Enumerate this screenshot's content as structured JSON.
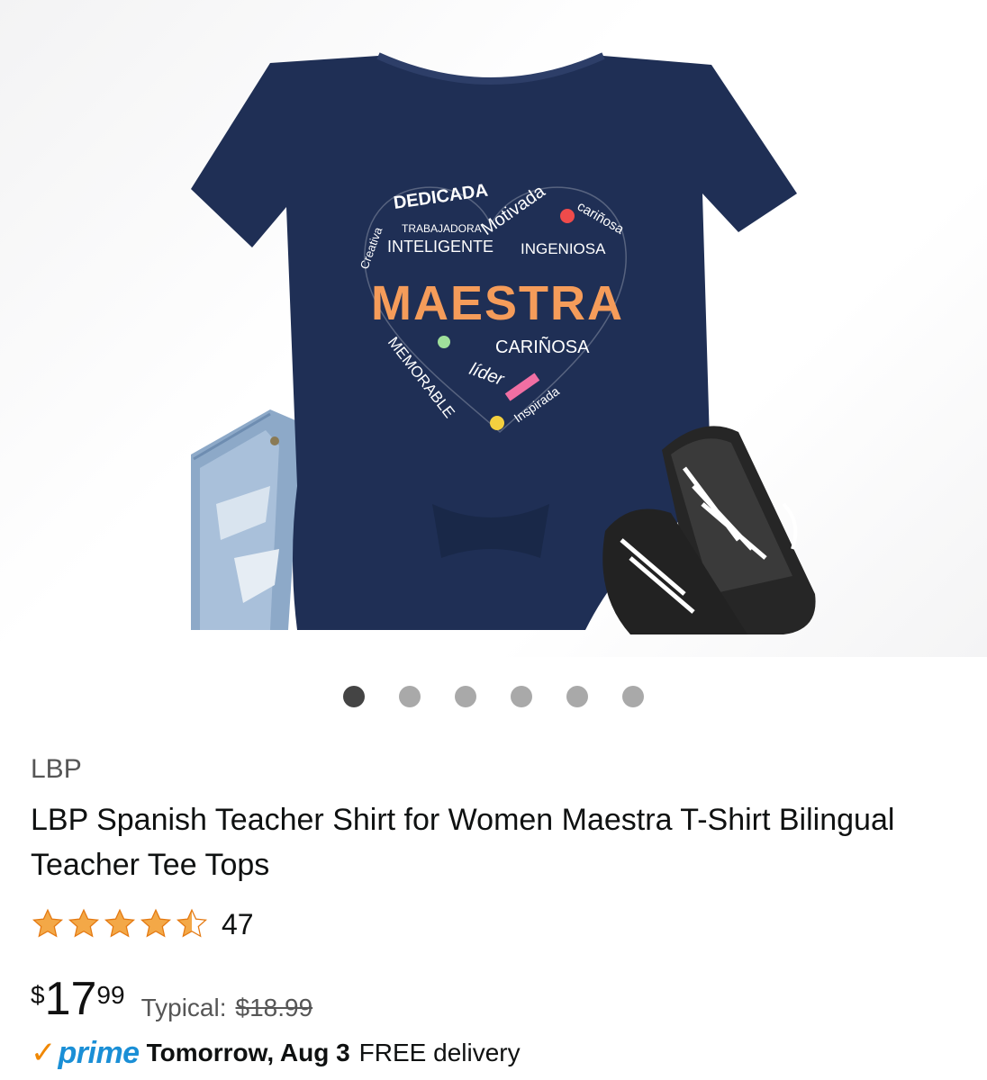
{
  "product": {
    "image_alt": "Navy heart Maestra t-shirt",
    "shirt_words": {
      "main": "MAESTRA",
      "dedicada": "DEDICADA",
      "creativa": "Creativa",
      "trabajadora": "TRABAJADORA",
      "inteligente": "INTELIGENTE",
      "motivada": "Motivada",
      "carinosa_top": "cariñosa",
      "ingeniosa": "INGENIOSA",
      "carinosa": "CARIÑOSA",
      "memorable": "MEMORABLE",
      "lider": "líder",
      "inspirada": "Inspirada"
    },
    "carousel": {
      "count": 6,
      "active_index": 0
    },
    "brand": "LBP",
    "title": "LBP Spanish Teacher Shirt for Women Maestra T-Shirt Bilingual Teacher Tee Tops",
    "rating": {
      "value": 4.5,
      "count": "47",
      "star_color": "#f3a847"
    },
    "price": {
      "symbol": "$",
      "whole": "17",
      "fraction": "99",
      "typical_label": "Typical:",
      "typical_price": "$18.99"
    },
    "delivery": {
      "prime_check": "✓",
      "prime_label": "prime",
      "date": "Tomorrow, Aug 3",
      "note": "FREE delivery"
    }
  },
  "colors": {
    "shirt": "#1f2f55",
    "prime_blue": "#1a8fd6",
    "prime_orange": "#f08804"
  }
}
